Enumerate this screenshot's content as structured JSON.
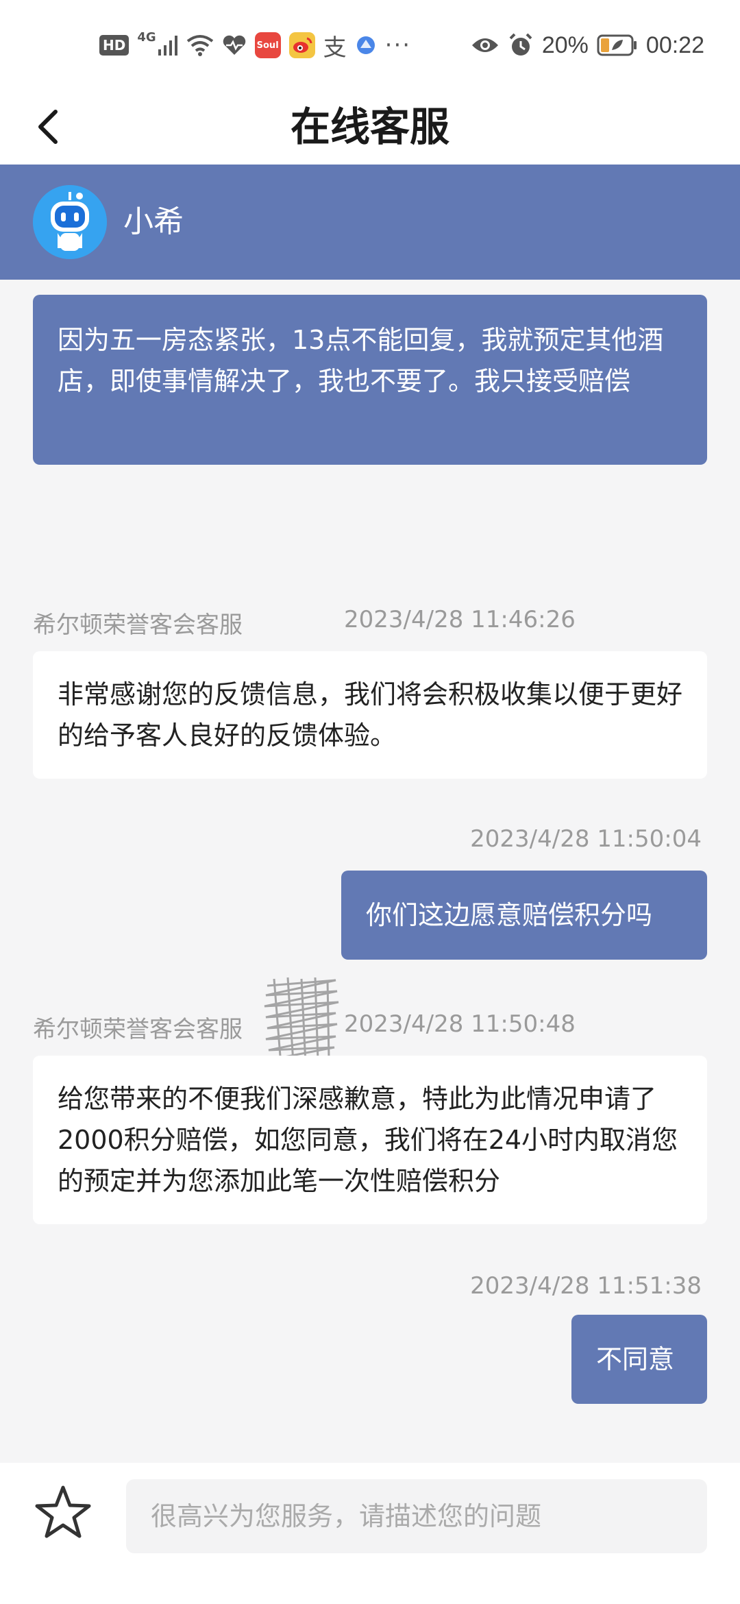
{
  "status_bar": {
    "hd_label": "HD",
    "network_label": "4G",
    "app_badge_text": "Soul",
    "alipay_glyph": "支",
    "more_dots": "···",
    "battery_percent": "20%",
    "time": "00:22"
  },
  "header": {
    "title": "在线客服"
  },
  "agent": {
    "name": "小希"
  },
  "messages": [
    {
      "sender": "user",
      "text": "因为五一房态紧张，13点不能回复，我就预定其他酒店，即使事情解决了，我也不要了。我只接受赔偿"
    },
    {
      "sender": "agent",
      "agent_name": "希尔顿荣誉客会客服",
      "timestamp": "2023/4/28 11:46:26",
      "text": "非常感谢您的反馈信息，我们将会积极收集以便于更好的给予客人良好的反馈体验。"
    },
    {
      "sender": "user",
      "timestamp": "2023/4/28 11:50:04",
      "text": "你们这边愿意赔偿积分吗"
    },
    {
      "sender": "agent",
      "agent_name": "希尔顿荣誉客会客服",
      "timestamp": "2023/4/28 11:50:48",
      "text": "给您带来的不便我们深感歉意，特此为此情况申请了2000积分赔偿，如您同意，我们将在24小时内取消您的预定并为您添加此笔一次性赔偿积分"
    },
    {
      "sender": "user",
      "timestamp": "2023/4/28 11:51:38",
      "text": "不同意"
    }
  ],
  "input": {
    "placeholder": "很高兴为您服务，请描述您的问题"
  },
  "colors": {
    "accent": "#6279b4",
    "user_bubble": "#6279b4",
    "agent_bubble": "#ffffff",
    "background": "#f5f5f6"
  },
  "icons": [
    "back-arrow-icon",
    "robot-avatar-icon",
    "star-icon",
    "wifi-icon",
    "signal-icon",
    "eye-icon",
    "alarm-icon",
    "battery-icon"
  ]
}
